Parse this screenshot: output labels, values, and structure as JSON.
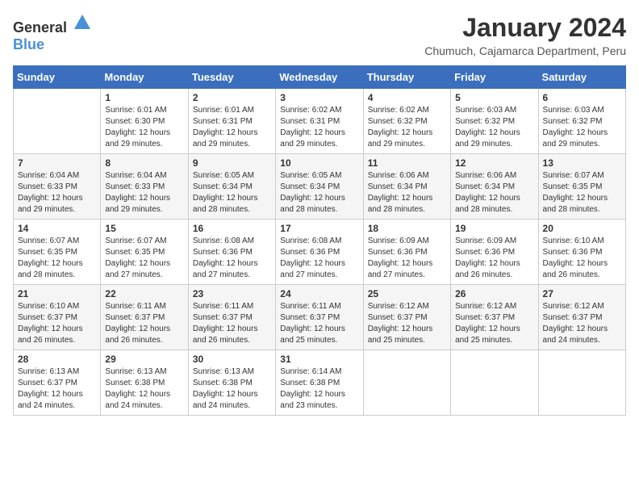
{
  "header": {
    "logo_general": "General",
    "logo_blue": "Blue",
    "month_year": "January 2024",
    "location": "Chumuch, Cajamarca Department, Peru"
  },
  "days_of_week": [
    "Sunday",
    "Monday",
    "Tuesday",
    "Wednesday",
    "Thursday",
    "Friday",
    "Saturday"
  ],
  "weeks": [
    [
      {
        "day": "",
        "info": ""
      },
      {
        "day": "1",
        "info": "Sunrise: 6:01 AM\nSunset: 6:30 PM\nDaylight: 12 hours\nand 29 minutes."
      },
      {
        "day": "2",
        "info": "Sunrise: 6:01 AM\nSunset: 6:31 PM\nDaylight: 12 hours\nand 29 minutes."
      },
      {
        "day": "3",
        "info": "Sunrise: 6:02 AM\nSunset: 6:31 PM\nDaylight: 12 hours\nand 29 minutes."
      },
      {
        "day": "4",
        "info": "Sunrise: 6:02 AM\nSunset: 6:32 PM\nDaylight: 12 hours\nand 29 minutes."
      },
      {
        "day": "5",
        "info": "Sunrise: 6:03 AM\nSunset: 6:32 PM\nDaylight: 12 hours\nand 29 minutes."
      },
      {
        "day": "6",
        "info": "Sunrise: 6:03 AM\nSunset: 6:32 PM\nDaylight: 12 hours\nand 29 minutes."
      }
    ],
    [
      {
        "day": "7",
        "info": ""
      },
      {
        "day": "8",
        "info": "Sunrise: 6:04 AM\nSunset: 6:33 PM\nDaylight: 12 hours\nand 29 minutes."
      },
      {
        "day": "9",
        "info": "Sunrise: 6:05 AM\nSunset: 6:34 PM\nDaylight: 12 hours\nand 28 minutes."
      },
      {
        "day": "10",
        "info": "Sunrise: 6:05 AM\nSunset: 6:34 PM\nDaylight: 12 hours\nand 28 minutes."
      },
      {
        "day": "11",
        "info": "Sunrise: 6:06 AM\nSunset: 6:34 PM\nDaylight: 12 hours\nand 28 minutes."
      },
      {
        "day": "12",
        "info": "Sunrise: 6:06 AM\nSunset: 6:34 PM\nDaylight: 12 hours\nand 28 minutes."
      },
      {
        "day": "13",
        "info": "Sunrise: 6:07 AM\nSunset: 6:35 PM\nDaylight: 12 hours\nand 28 minutes."
      }
    ],
    [
      {
        "day": "14",
        "info": ""
      },
      {
        "day": "15",
        "info": "Sunrise: 6:07 AM\nSunset: 6:35 PM\nDaylight: 12 hours\nand 27 minutes."
      },
      {
        "day": "16",
        "info": "Sunrise: 6:08 AM\nSunset: 6:36 PM\nDaylight: 12 hours\nand 27 minutes."
      },
      {
        "day": "17",
        "info": "Sunrise: 6:08 AM\nSunset: 6:36 PM\nDaylight: 12 hours\nand 27 minutes."
      },
      {
        "day": "18",
        "info": "Sunrise: 6:09 AM\nSunset: 6:36 PM\nDaylight: 12 hours\nand 27 minutes."
      },
      {
        "day": "19",
        "info": "Sunrise: 6:09 AM\nSunset: 6:36 PM\nDaylight: 12 hours\nand 26 minutes."
      },
      {
        "day": "20",
        "info": "Sunrise: 6:10 AM\nSunset: 6:36 PM\nDaylight: 12 hours\nand 26 minutes."
      }
    ],
    [
      {
        "day": "21",
        "info": ""
      },
      {
        "day": "22",
        "info": "Sunrise: 6:11 AM\nSunset: 6:37 PM\nDaylight: 12 hours\nand 26 minutes."
      },
      {
        "day": "23",
        "info": "Sunrise: 6:11 AM\nSunset: 6:37 PM\nDaylight: 12 hours\nand 26 minutes."
      },
      {
        "day": "24",
        "info": "Sunrise: 6:11 AM\nSunset: 6:37 PM\nDaylight: 12 hours\nand 25 minutes."
      },
      {
        "day": "25",
        "info": "Sunrise: 6:12 AM\nSunset: 6:37 PM\nDaylight: 12 hours\nand 25 minutes."
      },
      {
        "day": "26",
        "info": "Sunrise: 6:12 AM\nSunset: 6:37 PM\nDaylight: 12 hours\nand 25 minutes."
      },
      {
        "day": "27",
        "info": "Sunrise: 6:12 AM\nSunset: 6:37 PM\nDaylight: 12 hours\nand 24 minutes."
      }
    ],
    [
      {
        "day": "28",
        "info": "Sunrise: 6:13 AM\nSunset: 6:37 PM\nDaylight: 12 hours\nand 24 minutes."
      },
      {
        "day": "29",
        "info": "Sunrise: 6:13 AM\nSunset: 6:38 PM\nDaylight: 12 hours\nand 24 minutes."
      },
      {
        "day": "30",
        "info": "Sunrise: 6:13 AM\nSunset: 6:38 PM\nDaylight: 12 hours\nand 24 minutes."
      },
      {
        "day": "31",
        "info": "Sunrise: 6:14 AM\nSunset: 6:38 PM\nDaylight: 12 hours\nand 23 minutes."
      },
      {
        "day": "",
        "info": ""
      },
      {
        "day": "",
        "info": ""
      },
      {
        "day": "",
        "info": ""
      }
    ]
  ],
  "week7_sunday": {
    "day": "7",
    "info": "Sunrise: 6:04 AM\nSunset: 6:33 PM\nDaylight: 12 hours\nand 29 minutes."
  },
  "week14_sunday": {
    "day": "14",
    "info": "Sunrise: 6:07 AM\nSunset: 6:35 PM\nDaylight: 12 hours\nand 28 minutes."
  },
  "week21_sunday": {
    "day": "21",
    "info": "Sunrise: 6:10 AM\nSunset: 6:37 PM\nDaylight: 12 hours\nand 26 minutes."
  }
}
